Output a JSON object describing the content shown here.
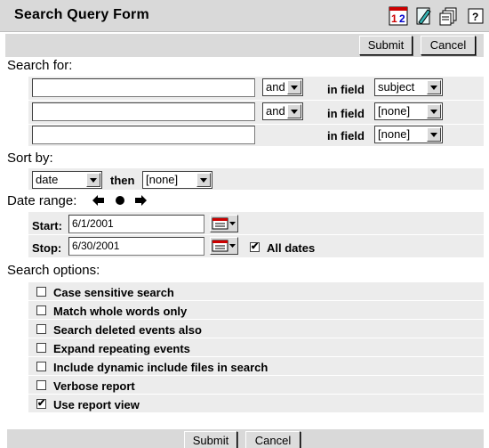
{
  "title": "Search Query Form",
  "toolbar": {
    "submit_label": "Submit",
    "cancel_label": "Cancel"
  },
  "search_for": {
    "heading": "Search for:",
    "in_field_label": "in field",
    "rows": [
      {
        "value": "",
        "op": "and",
        "field": "subject"
      },
      {
        "value": "",
        "op": "and",
        "field": "[none]"
      },
      {
        "value": "",
        "field": "[none]"
      }
    ]
  },
  "sort_by": {
    "heading": "Sort by:",
    "primary": "date",
    "then_label": "then",
    "secondary": "[none]"
  },
  "date_range": {
    "heading": "Date range:",
    "start_label": "Start:",
    "start_value": "6/1/2001",
    "stop_label": "Stop:",
    "stop_value": "6/30/2001",
    "all_dates_label": "All dates",
    "all_dates_checked": true
  },
  "search_options": {
    "heading": "Search options:",
    "items": [
      {
        "label": "Case sensitive search",
        "checked": false
      },
      {
        "label": "Match whole words only",
        "checked": false
      },
      {
        "label": "Search deleted events also",
        "checked": false
      },
      {
        "label": "Expand repeating events",
        "checked": false
      },
      {
        "label": "Include dynamic include files in search",
        "checked": false
      },
      {
        "label": "Verbose report",
        "checked": false
      },
      {
        "label": "Use report view",
        "checked": true
      }
    ]
  },
  "footer": {
    "submit_label": "Submit",
    "cancel_label": "Cancel"
  },
  "icons": [
    "calendar-12-icon",
    "edit-pen-icon",
    "copy-pages-icon",
    "help-icon",
    "prev-arrow-icon",
    "today-dot-icon",
    "next-arrow-icon",
    "date-picker-icon"
  ]
}
